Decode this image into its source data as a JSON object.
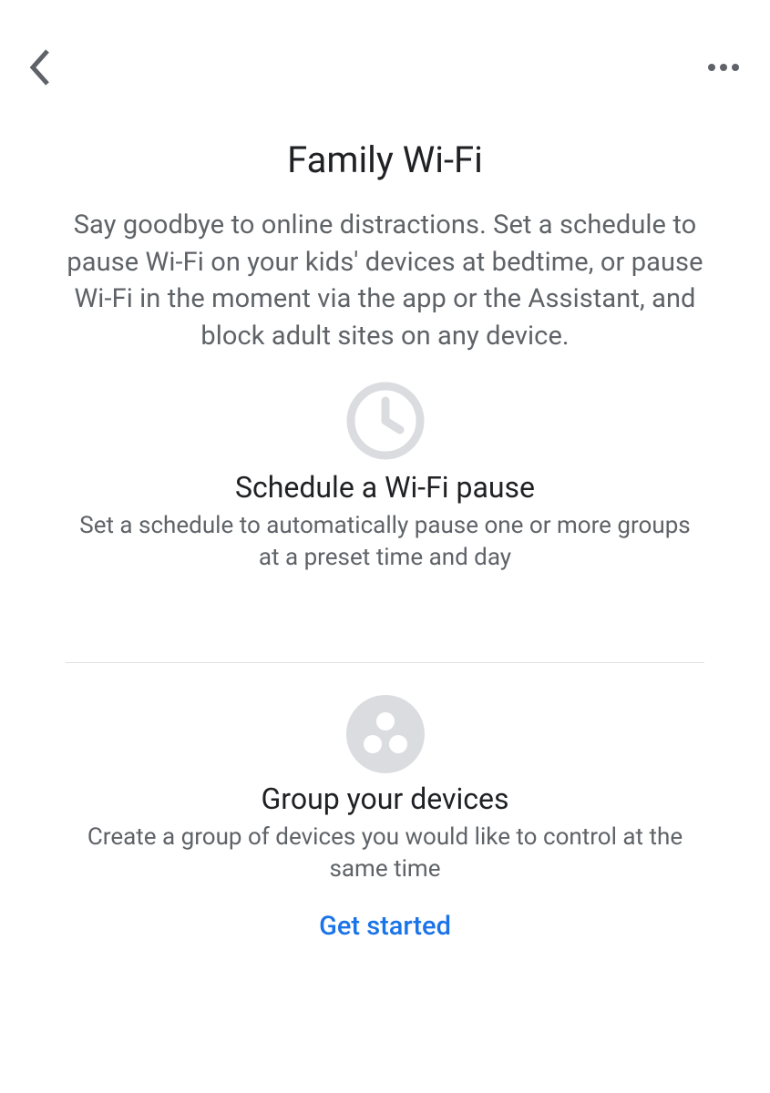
{
  "page": {
    "title": "Family Wi-Fi",
    "description": "Say goodbye to online distractions. Set a schedule to pause Wi-Fi on your kids' devices at bedtime, or pause Wi-Fi in the moment via the app or the Assistant, and block adult sites on any device."
  },
  "features": {
    "schedule": {
      "title": "Schedule a Wi-Fi pause",
      "subtitle": "Set a schedule to automatically pause one or more groups at a preset time and day"
    },
    "group": {
      "title": "Group your devices",
      "subtitle": "Create a group of devices you would like to control at the same time",
      "cta": "Get started"
    }
  },
  "colors": {
    "textPrimary": "#202124",
    "textSecondary": "#5f6368",
    "accent": "#1a73e8",
    "iconGray": "#dadce0"
  }
}
